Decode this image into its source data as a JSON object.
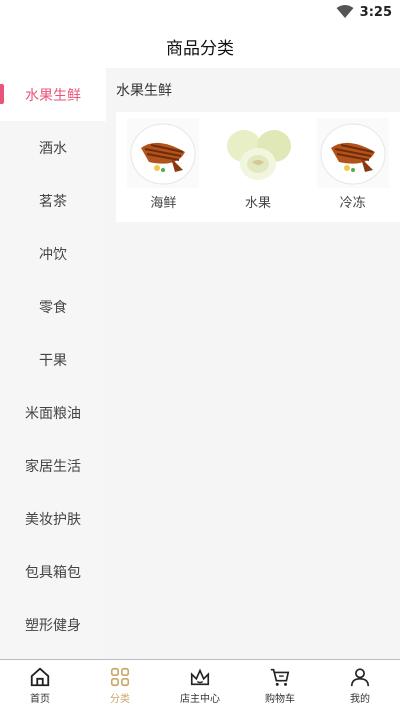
{
  "status": {
    "time": "3:25"
  },
  "header": {
    "title": "商品分类"
  },
  "sidebar": {
    "items": [
      {
        "label": "水果生鲜",
        "active": true
      },
      {
        "label": "酒水"
      },
      {
        "label": "茗茶"
      },
      {
        "label": "冲饮"
      },
      {
        "label": "零食"
      },
      {
        "label": "干果"
      },
      {
        "label": "米面粮油"
      },
      {
        "label": "家居生活"
      },
      {
        "label": "美妆护肤"
      },
      {
        "label": "包具箱包"
      },
      {
        "label": "塑形健身"
      }
    ]
  },
  "main": {
    "section_title": "水果生鲜",
    "categories": [
      {
        "label": "海鲜",
        "icon": "grilled-fish-image"
      },
      {
        "label": "水果",
        "icon": "melon-image"
      },
      {
        "label": "冷冻",
        "icon": "grilled-fish-image"
      }
    ]
  },
  "tabbar": {
    "accent": "#c9a96a",
    "items": [
      {
        "label": "首页",
        "icon": "home-icon"
      },
      {
        "label": "分类",
        "icon": "grid-icon",
        "active": true
      },
      {
        "label": "店主中心",
        "icon": "crown-icon"
      },
      {
        "label": "购物车",
        "icon": "cart-icon"
      },
      {
        "label": "我的",
        "icon": "person-icon"
      }
    ]
  }
}
